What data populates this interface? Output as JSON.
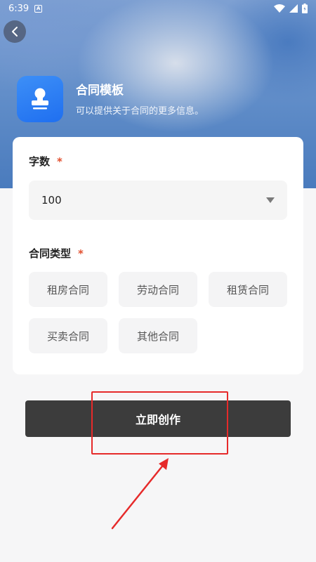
{
  "status_bar": {
    "time": "6:39",
    "app_notification_letter": "A"
  },
  "header": {
    "back_icon": "chevron-left-icon",
    "app_icon": "stamp-icon",
    "title": "合同模板",
    "subtitle": "可以提供关于合同的更多信息。"
  },
  "form": {
    "word_count": {
      "label": "字数",
      "required_mark": "*",
      "value": "100",
      "dropdown_icon": "caret-down-icon"
    },
    "contract_type": {
      "label": "合同类型",
      "required_mark": "*",
      "options": [
        "租房合同",
        "劳动合同",
        "租赁合同",
        "买卖合同",
        "其他合同"
      ]
    }
  },
  "actions": {
    "create_label": "立即创作"
  },
  "colors": {
    "accent_blue": "#2f7ff5",
    "button_dark": "#3c3c3c",
    "required_red": "#e2502f",
    "annotation_red": "#e62a2a"
  }
}
